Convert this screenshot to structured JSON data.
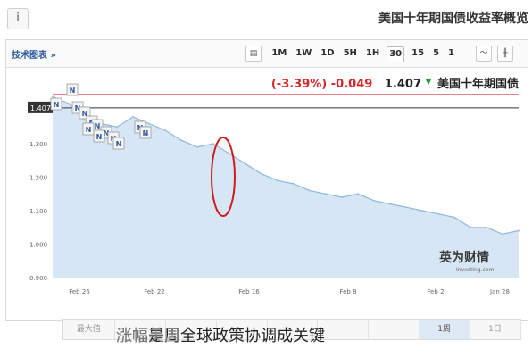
{
  "header": {
    "info_glyph": "i",
    "title": "美国十年期国债收益率概览"
  },
  "toolbar": {
    "tech_link": "技术图表 »",
    "timeframes": [
      "1",
      "5",
      "15",
      "30",
      "1H",
      "5H",
      "1D",
      "1W",
      "1M"
    ],
    "active_timeframe": "30",
    "icons": [
      "candlestick-icon",
      "line-chart-icon",
      "calendar-icon"
    ]
  },
  "quote": {
    "name": "美国十年期国债",
    "price": "1.407",
    "change": "-0.049",
    "change_pct": "(-3.39%)",
    "direction": "down",
    "arrow_color": "#1a9a3a",
    "change_color": "#d62828"
  },
  "chart": {
    "current_price_label": "1.407",
    "line_color": "#8fb8dc",
    "fill_color": "#d6e6f4",
    "reference_line_color": "#d43a3a",
    "annotation_color": "#d21b1b",
    "watermark_cn": "英为财情",
    "watermark_en": "Investing.com",
    "news_markers": [
      "N",
      "N",
      "N",
      "N",
      "N",
      "N",
      "N",
      "N",
      "N",
      "N",
      "N",
      "N",
      "N"
    ]
  },
  "chart_data": {
    "type": "area",
    "title": "",
    "xlabel": "",
    "ylabel": "",
    "x_ticks": [
      "Feb 26",
      "Feb 22",
      "Feb 16",
      "Feb 8",
      "Feb 2",
      "Jan 28"
    ],
    "y_ticks": [
      "1.407",
      "1.300",
      "1.200",
      "1.100",
      "1.000",
      "0.900"
    ],
    "ylim": [
      0.9,
      1.46
    ],
    "x_direction": "right-to-left (newest on left)",
    "grid": false,
    "series": [
      {
        "name": "",
        "values": [
          1.44,
          1.42,
          1.37,
          1.36,
          1.35,
          1.38,
          1.36,
          1.34,
          1.31,
          1.29,
          1.3,
          1.27,
          1.24,
          1.21,
          1.19,
          1.18,
          1.16,
          1.15,
          1.14,
          1.15,
          1.13,
          1.12,
          1.11,
          1.1,
          1.09,
          1.08,
          1.05,
          1.05,
          1.03,
          1.04
        ]
      }
    ],
    "reference_line": 1.407
  },
  "range_bar": {
    "items": [
      "最大值",
      "",
      "",
      "",
      "",
      "",
      "",
      "1周",
      "1日"
    ],
    "active_index": 7
  },
  "caption": {
    "text": "涨幅是周全球政策协调成关键",
    "ghost_text": "涨幅美国"
  }
}
